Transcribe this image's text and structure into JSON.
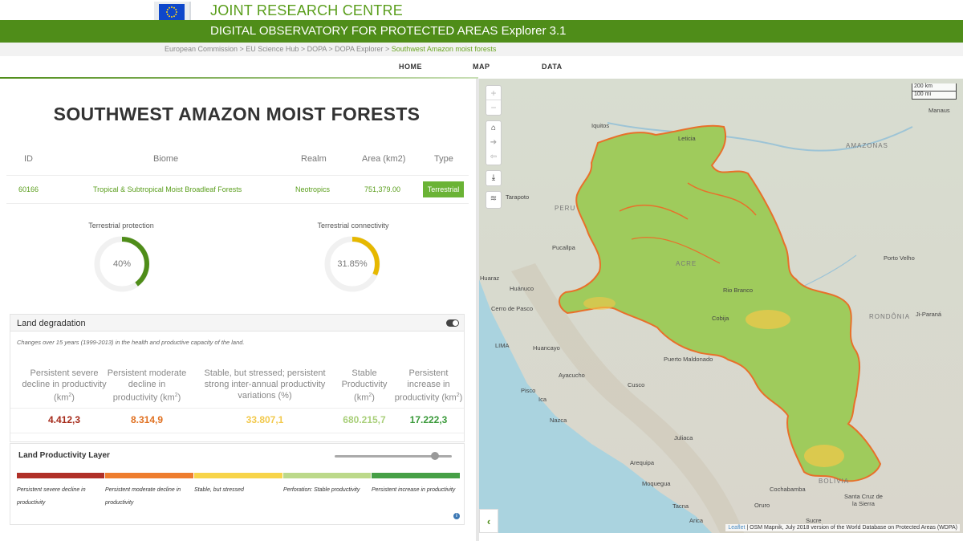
{
  "header": {
    "org_title": "JOINT RESEARCH CENTRE",
    "app_title": "DIGITAL OBSERVATORY FOR PROTECTED AREAS",
    "app_version": "Explorer 3.1",
    "logo_alt": "European Commission"
  },
  "breadcrumb": {
    "path": "European Commission > EU Science Hub > DOPA > DOPA Explorer > ",
    "current": "Southwest Amazon moist forests"
  },
  "nav": {
    "home": "HOME",
    "map": "MAP",
    "data": "DATA"
  },
  "page": {
    "title": "SOUTHWEST AMAZON MOIST FORESTS"
  },
  "info": {
    "headers": {
      "id": "ID",
      "biome": "Biome",
      "realm": "Realm",
      "area": "Area (km2)",
      "type": "Type"
    },
    "values": {
      "id": "60166",
      "biome": "Tropical & Subtropical Moist Broadleaf Forests",
      "realm": "Neotropics",
      "area": "751,379.00",
      "type": "Terrestrial"
    }
  },
  "gauges": {
    "protection": {
      "label": "Terrestrial protection",
      "value_text": "40%",
      "fraction": 0.4,
      "color": "#4f8d19"
    },
    "connectivity": {
      "label": "Terrestrial connectivity",
      "value_text": "31.85%",
      "fraction": 0.3185,
      "color": "#e6b800"
    }
  },
  "land_degradation": {
    "title": "Land degradation",
    "note": "Changes over 15 years (1999-2013) in the health and productive capacity of the land.",
    "columns": [
      {
        "header": "Persistent severe decline in productivity (km",
        "sup": "2",
        "tail": ")",
        "value": "4.412,3",
        "color": "#a52a1a"
      },
      {
        "header": "Persistent moderate decline in productivity (km",
        "sup": "2",
        "tail": ")",
        "value": "8.314,9",
        "color": "#e07020"
      },
      {
        "header": "Stable, but stressed; persistent strong inter-annual productivity variations (%)",
        "sup": "",
        "tail": "",
        "value": "33.807,1",
        "color": "#f2c94c"
      },
      {
        "header": "Stable Productivity (km",
        "sup": "2",
        "tail": ")",
        "value": "680.215,7",
        "color": "#a9cf7a"
      },
      {
        "header": "Persistent increase in productivity (km",
        "sup": "2",
        "tail": ")",
        "value": "17.222,3",
        "color": "#3a9a3a"
      }
    ]
  },
  "productivity_layer": {
    "title": "Land Productivity Layer",
    "legend": [
      {
        "label": "Persistent severe decline in productivity",
        "color": "#b03028"
      },
      {
        "label": "Persistent moderate decline in productivity",
        "color": "#ee7d2e"
      },
      {
        "label": "Stable, but stressed",
        "color": "#f7d44a"
      },
      {
        "label": "Perforation: Stable productivity",
        "color": "#bcd98a"
      },
      {
        "label": "Persistent increase in productivity",
        "color": "#46a046"
      }
    ],
    "info_icon": "i"
  },
  "map": {
    "zoom_in": "+",
    "zoom_out": "−",
    "scale_km": "200 km",
    "scale_mi": "100 mi",
    "attribution_link": "Leaflet",
    "attribution_text": " | OSM Mapnik, July 2018 version of the World Database on Protected Areas (WDPA)",
    "labels": {
      "manaus": "Manaus",
      "iquitos": "Iquitos",
      "leticia": "Leticia",
      "amazonas": "AMAZONAS",
      "tarapoto": "Tarapoto",
      "peru": "PERU",
      "pucallpa": "Pucallpa",
      "porto_velho": "Porto Velho",
      "acre": "ACRE",
      "huaraz": "Huaraz",
      "huanuco": "Huánuco",
      "rio_branco": "Rio Branco",
      "cerro_de_pasco": "Cerro de Pasco",
      "rondonia": "RONDÔNIA",
      "ji_parana": "Ji-Paraná",
      "cobija": "Cobija",
      "lima": "LIMA",
      "huancayo": "Huancayo",
      "puerto_maldonado": "Puerto Maldonado",
      "ayacucho": "Ayacucho",
      "cusco": "Cusco",
      "pisco": "Pisco",
      "ica": "Ica",
      "nazca": "Nazca",
      "juliaca": "Juliaca",
      "arequipa": "Arequipa",
      "moquegua": "Moquegua",
      "cochabamba": "Cochabamba",
      "bolivia": "BOLIVIA",
      "tacna": "Tacna",
      "oruro": "Oruro",
      "santa_cruz": "Santa Cruz de la Sierra",
      "arica": "Arica",
      "sucre": "Sucre"
    }
  }
}
